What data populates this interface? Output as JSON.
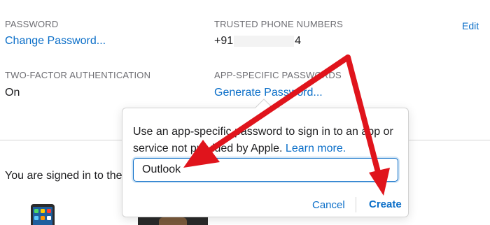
{
  "security": {
    "password": {
      "label": "PASSWORD",
      "link": "Change Password..."
    },
    "trusted_phones": {
      "label": "TRUSTED PHONE NUMBERS",
      "prefix": "+91",
      "suffix": "4",
      "edit": "Edit"
    },
    "two_factor": {
      "label": "TWO-FACTOR AUTHENTICATION",
      "value": "On"
    },
    "app_passwords": {
      "label": "APP-SPECIFIC PASSWORDS",
      "link": "Generate Password..."
    }
  },
  "devices": {
    "signed_in_text": "You are signed in to the"
  },
  "popover": {
    "description": "Use an app-specific password to sign in to an app or service not provided by Apple.",
    "learn_more": "Learn more.",
    "input_value": "Outlook",
    "cancel": "Cancel",
    "create": "Create"
  },
  "colors": {
    "link": "#0a6ec8",
    "annotation_arrow": "#e0141c"
  },
  "icons": [
    "arrow-annotation-icon"
  ]
}
